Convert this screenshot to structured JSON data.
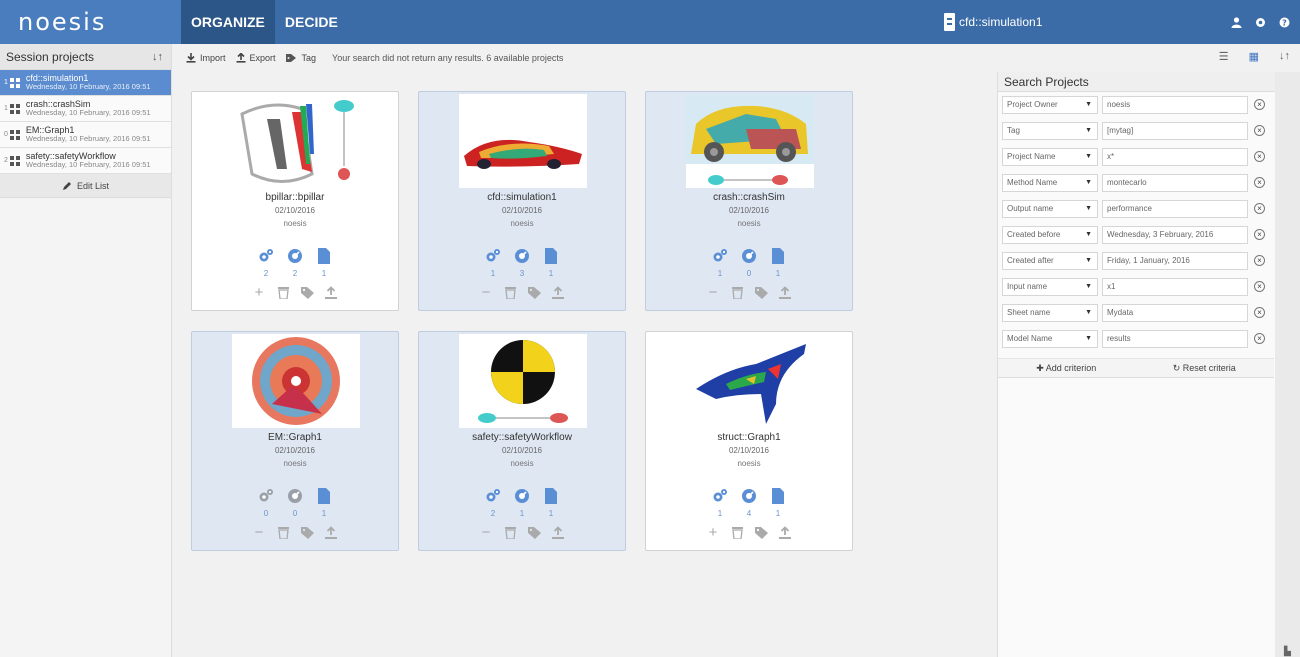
{
  "app": {
    "logo": "noesis"
  },
  "tabs": [
    {
      "label": "ORGANIZE"
    },
    {
      "label": "DECIDE"
    }
  ],
  "session": {
    "title": "cfd::simulation1"
  },
  "sidebar": {
    "title": "Session projects",
    "items": [
      {
        "name": "cfd::simulation1",
        "date": "Wednesday, 10 February, 2016 09:51",
        "count": "1"
      },
      {
        "name": "crash::crashSim",
        "date": "Wednesday, 10 February, 2016 09:51",
        "count": "1"
      },
      {
        "name": "EM::Graph1",
        "date": "Wednesday, 10 February, 2016 09:51",
        "count": "0"
      },
      {
        "name": "safety::safetyWorkflow",
        "date": "Wednesday, 10 February, 2016 09:51",
        "count": "2"
      }
    ],
    "edit_label": "Edit List"
  },
  "toolbar": {
    "import_label": "Import",
    "export_label": "Export",
    "tag_label": "Tag",
    "message": "Your search did not return any results. 6 available projects"
  },
  "projects": [
    {
      "name": "bpillar::bpillar",
      "date": "02/10/2016",
      "owner": "noesis",
      "stats": [
        "2",
        "2",
        "1"
      ]
    },
    {
      "name": "cfd::simulation1",
      "date": "02/10/2016",
      "owner": "noesis",
      "stats": [
        "1",
        "3",
        "1"
      ]
    },
    {
      "name": "crash::crashSim",
      "date": "02/10/2016",
      "owner": "noesis",
      "stats": [
        "1",
        "0",
        "1"
      ]
    },
    {
      "name": "EM::Graph1",
      "date": "02/10/2016",
      "owner": "noesis",
      "stats": [
        "0",
        "0",
        "1"
      ]
    },
    {
      "name": "safety::safetyWorkflow",
      "date": "02/10/2016",
      "owner": "noesis",
      "stats": [
        "2",
        "1",
        "1"
      ]
    },
    {
      "name": "struct::Graph1",
      "date": "02/10/2016",
      "owner": "noesis",
      "stats": [
        "1",
        "4",
        "1"
      ]
    }
  ],
  "search": {
    "title": "Search Projects",
    "criteria": [
      {
        "field": "Project Owner",
        "value": "noesis"
      },
      {
        "field": "Tag",
        "value": "[mytag]"
      },
      {
        "field": "Project Name",
        "value": "x*"
      },
      {
        "field": "Method Name",
        "value": "montecarlo"
      },
      {
        "field": "Output name",
        "value": "performance"
      },
      {
        "field": "Created before",
        "value": "Wednesday, 3 February, 2016"
      },
      {
        "field": "Created after",
        "value": "Friday, 1 January, 2016"
      },
      {
        "field": "Input name",
        "value": "x1"
      },
      {
        "field": "Sheet name",
        "value": "Mydata"
      },
      {
        "field": "Model Name",
        "value": "results"
      }
    ],
    "add_label": "Add criterion",
    "reset_label": "Reset criteria"
  }
}
